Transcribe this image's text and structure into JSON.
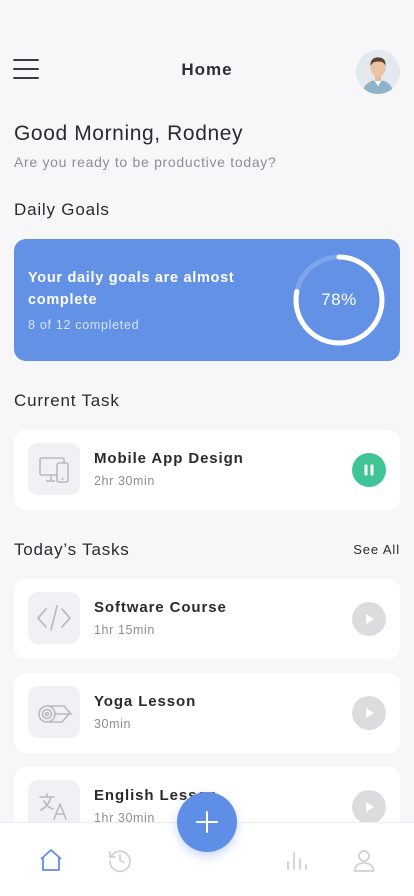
{
  "header": {
    "title": "Home",
    "menu_icon": "hamburger-menu-icon",
    "avatar_icon": "user-avatar"
  },
  "greeting": {
    "title": "Good Morning, Rodney",
    "subtitle": "Are you ready to be productive today?"
  },
  "daily_goals": {
    "section_title": "Daily Goals",
    "message": "Your daily goals are almost complete",
    "progress_text": "8 of 12 completed",
    "completed": 8,
    "total": 12,
    "percent_label": "78%",
    "percent": 78,
    "card_color": "#6391e6"
  },
  "current_task": {
    "section_title": "Current Task",
    "name": "Mobile App Design",
    "duration": "2hr 30min",
    "icon": "devices-icon",
    "action_icon": "pause-icon",
    "action_color": "#3fc595"
  },
  "todays_tasks": {
    "section_title": "Today’s Tasks",
    "see_all_label": "See All",
    "items": [
      {
        "name": "Software Course",
        "duration": "1hr 15min",
        "icon": "code-icon"
      },
      {
        "name": "Yoga Lesson",
        "duration": "30min",
        "icon": "yoga-mat-icon"
      },
      {
        "name": "English Lesson",
        "duration": "1hr 30min",
        "icon": "translate-icon"
      }
    ]
  },
  "bottom_nav": {
    "items": [
      {
        "icon": "home-icon",
        "active": true
      },
      {
        "icon": "history-icon",
        "active": false
      },
      {
        "icon": "stats-icon",
        "active": false
      },
      {
        "icon": "profile-icon",
        "active": false
      }
    ],
    "fab_icon": "plus-icon",
    "accent_color": "#5f8ee6"
  }
}
